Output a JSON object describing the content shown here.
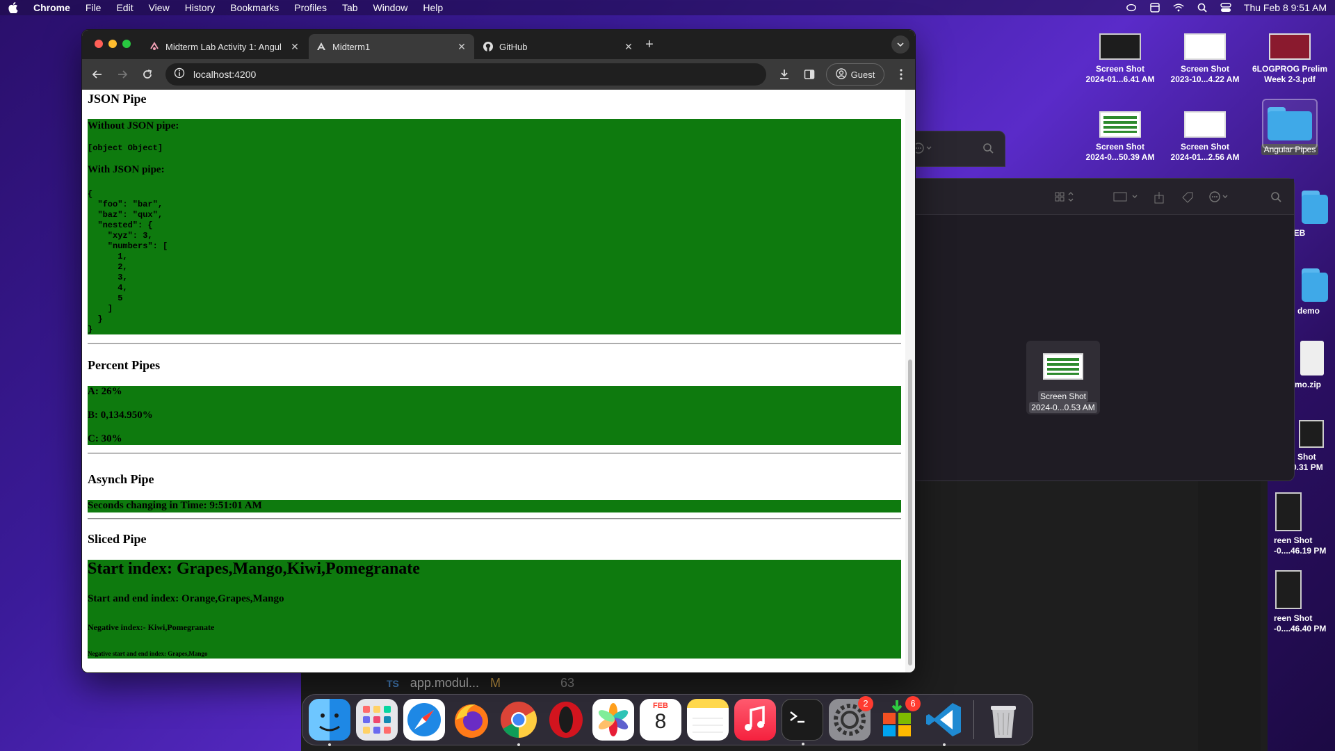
{
  "menubar": {
    "app": "Chrome",
    "items": [
      "File",
      "Edit",
      "View",
      "History",
      "Bookmarks",
      "Profiles",
      "Tab",
      "Window",
      "Help"
    ],
    "clock": "Thu Feb 8  9:51 AM"
  },
  "desktop": {
    "icons": [
      {
        "line1": "Screen Shot",
        "line2": "2024-01...6.41 AM"
      },
      {
        "line1": "Screen Shot",
        "line2": "2023-10...4.22 AM"
      },
      {
        "line1": "6LOGPROG Prelim",
        "line2": "Week 2-3.pdf"
      },
      {
        "line1": "Screen Shot",
        "line2": "2024-0...50.39 AM"
      },
      {
        "line1": "Screen Shot",
        "line2": "2024-01...2.56 AM"
      },
      {
        "line1": "Angular Pipes",
        "line2": ""
      },
      {
        "line1": "ADWEB",
        "line2": ""
      },
      {
        "line1": "demo",
        "line2": ""
      },
      {
        "line1": "mo.zip",
        "line2": ""
      },
      {
        "line1": "Shot",
        "line2": "0.31 PM"
      },
      {
        "line1": "reen Shot",
        "line2": "-0....46.19 PM"
      },
      {
        "line1": "reen Shot",
        "line2": "-0....46.40 PM"
      }
    ],
    "finder_selected": {
      "line1": "Screen Shot",
      "line2": "2024-0...0.53 AM"
    }
  },
  "vscode": {
    "tab_badge": "TS",
    "tab_name": "app.modul...",
    "tab_status": "M",
    "line_no": "63"
  },
  "chrome": {
    "tabs": [
      {
        "title": "Midterm Lab Activity 1: Angul",
        "active": false
      },
      {
        "title": "Midterm1",
        "active": true
      },
      {
        "title": "GitHub",
        "active": false
      }
    ],
    "url": "localhost:4200",
    "profile": "Guest"
  },
  "page": {
    "json_section": {
      "heading": "JSON Pipe",
      "without_label": "Without JSON pipe:",
      "without_value": "[object Object]",
      "with_label": "With JSON pipe:",
      "with_value": "{\n  \"foo\": \"bar\",\n  \"baz\": \"qux\",\n  \"nested\": {\n    \"xyz\": 3,\n    \"numbers\": [\n      1,\n      2,\n      3,\n      4,\n      5\n    ]\n  }\n}"
    },
    "percent_section": {
      "heading": "Percent Pipes",
      "a": "A: 26%",
      "b": "B: 0,134.950%",
      "c": "C: 30%"
    },
    "async_section": {
      "heading": "Asynch Pipe",
      "text": "Seconds changing in Time: 9:51:01 AM"
    },
    "sliced_section": {
      "heading": "Sliced Pipe",
      "start": "Start index: Grapes,Mango,Kiwi,Pomegranate",
      "start_end": "Start and end index: Orange,Grapes,Mango",
      "negative": "Negative index:- Kiwi,Pomegranate",
      "negative_start_end": "Negative start and end index: Grapes,Mango"
    }
  },
  "dock": {
    "apps": [
      "finder",
      "launchpad",
      "safari",
      "firefox",
      "chrome",
      "opera",
      "photos",
      "calendar",
      "notes",
      "music",
      "terminal",
      "system-settings",
      "app-store-ms",
      "vscode",
      "trash"
    ],
    "calendar_month": "FEB",
    "calendar_day": "8",
    "settings_badge": "2",
    "ms_badge": "6"
  },
  "colors": {
    "page_green": "#0e7a0e",
    "chrome_dark": "#1f1f1f"
  }
}
